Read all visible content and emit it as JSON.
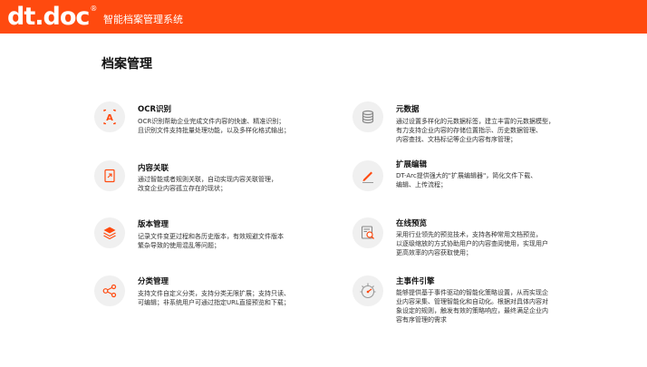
{
  "header": {
    "logo": "dt.doc",
    "registered": "®",
    "subtitle": "智能档案管理系统",
    "bg_color": "#ff4a0f"
  },
  "page": {
    "title": "档案管理"
  },
  "features": [
    {
      "icon": "ocr-icon",
      "title": "OCR识别",
      "desc": [
        "OCR识别帮助企业完成文件内容的快速、精准识别；",
        "且识别文件支持批量处理功能，以及多样化格式输出；"
      ]
    },
    {
      "icon": "database-icon",
      "title": "元数据",
      "desc": [
        "通过设置多样化的元数据标签，建立丰富的元数据模型，",
        "有力支持企业内容的存储位置指示、历史数据管理、",
        "内容查找、文档标记等企业内容有序管理；"
      ]
    },
    {
      "icon": "link-document-icon",
      "title": "内容关联",
      "desc": [
        "通过智能或者规则关联，自动实现内容关联管理，",
        "改变企业内容孤立存在的现状；"
      ]
    },
    {
      "icon": "edit-pen-icon",
      "title": "扩展编辑",
      "desc": [
        "DT-Arc提供强大的\"扩展编辑器\"，简化文件下载、",
        "编辑、上传流程；"
      ]
    },
    {
      "icon": "layers-icon",
      "title": "版本管理",
      "desc": [
        "记录文件变更过程和各历史版本，有效规避文件版本",
        "繁杂导致的使用混乱等问题；"
      ]
    },
    {
      "icon": "preview-search-icon",
      "title": "在线预览",
      "desc": [
        "采用行业领先的预览技术，支持各种常用文档预览，",
        "以逐级缩放的方式协助用户的内容查阅使用，实现用户",
        "更高效率的内容获取使用；"
      ]
    },
    {
      "icon": "share-icon",
      "title": "分类管理",
      "desc": [
        "支持文件自定义分类，支持分类无限扩展；支持只读、",
        "可编辑；非系统用户可通过指定URL直接预览和下载；"
      ]
    },
    {
      "icon": "gear-gauge-icon",
      "title": "主事件引擎",
      "desc": [
        "能够提供基于事件驱动的智能化策略设置，从而实现企",
        "业内容采集、管理智能化和自动化。根据对具体内容对",
        "象设定的规则，触发有效的策略响应，最终满足企业内",
        "容有序管理的需求"
      ]
    }
  ]
}
